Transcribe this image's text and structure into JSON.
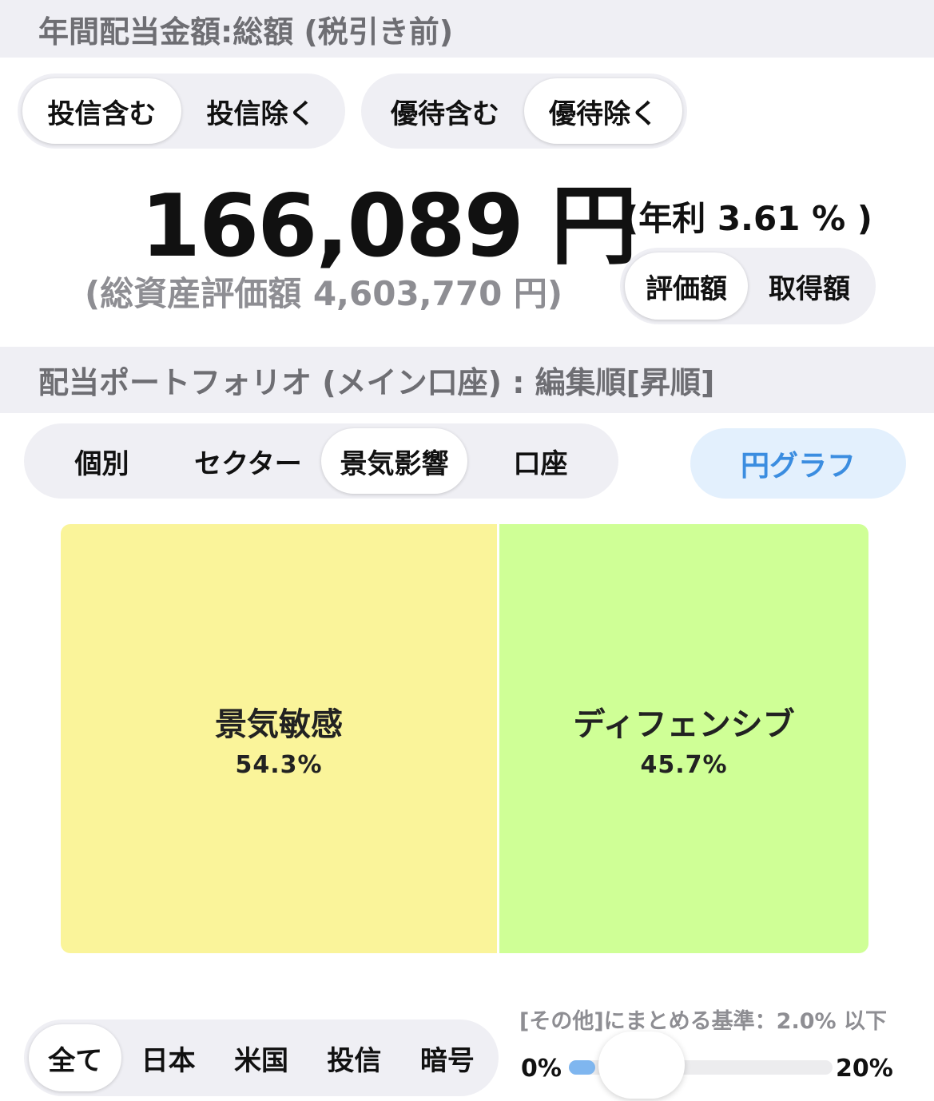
{
  "header1": {
    "title": "年間配当金額:総額 (税引き前)"
  },
  "fund_toggle": {
    "options": [
      "投信含む",
      "投信除く"
    ],
    "selected": 0
  },
  "yutai_toggle": {
    "options": [
      "優待含む",
      "優待除く"
    ],
    "selected": 1
  },
  "amount": {
    "value": "166,089 円",
    "yield": "(年利 3.61 % )"
  },
  "total_assets": {
    "text": "(総資産評価額 4,603,770 円)"
  },
  "basis_toggle": {
    "options": [
      "評価額",
      "取得額"
    ],
    "selected": 0
  },
  "header2": {
    "title": "配当ポートフォリオ (メイン口座) : 編集順[昇順]"
  },
  "category_tabs": {
    "options": [
      "個別",
      "セクター",
      "景気影響",
      "口座"
    ],
    "selected": 2
  },
  "pie_button": {
    "label": "円グラフ"
  },
  "chart_data": {
    "type": "treemap",
    "items": [
      {
        "name": "景気敏感",
        "label": "54.3%",
        "value": 54.3,
        "color": "#faf49a"
      },
      {
        "name": "ディフェンシブ",
        "label": "45.7%",
        "value": 45.7,
        "color": "#cfff96"
      }
    ]
  },
  "region_tabs": {
    "options": [
      "全て",
      "日本",
      "米国",
      "投信",
      "暗号"
    ],
    "selected": 0
  },
  "threshold": {
    "label": "[その他]にまとめる基準：2.0% 以下",
    "min_label": "0%",
    "max_label": "20%",
    "value_percent": 2.0,
    "max_percent": 20.0,
    "accent": "#7fb6ef"
  }
}
